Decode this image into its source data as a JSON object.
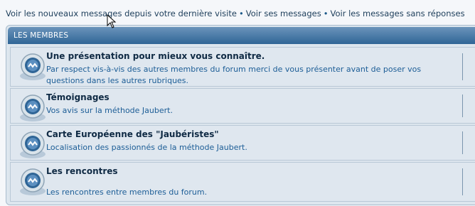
{
  "topnav": {
    "links": [
      "Voir les nouveaux messages depuis votre dernière visite",
      "Voir ses messages",
      "Voir les messages sans réponses"
    ],
    "separator": "•"
  },
  "forum": {
    "category_title": "LES MEMBRES",
    "rows": [
      {
        "title": "Une présentation pour mieux vous connaître.",
        "description": "Par respect vis-à-vis des autres membres du forum merci de vous présenter avant de poser vos questions dans les autres rubriques.",
        "icon": "forum-read-icon"
      },
      {
        "title": "Témoignages",
        "description": "Vos avis sur la méthode Jaubert.",
        "icon": "forum-read-icon"
      },
      {
        "title": "Carte Européenne des \"Jaubéristes\"",
        "description": "Localisation des passionnés de la méthode Jaubert.",
        "icon": "forum-read-icon"
      },
      {
        "title": "Les rencontres",
        "description": "Les rencontres entre membres du forum.",
        "icon": "forum-read-icon"
      }
    ]
  },
  "colors": {
    "link": "#1c3d5a",
    "header_gradient_top": "#6b94bb",
    "header_gradient_bottom": "#2f6596",
    "row_bg": "#dfe7ef",
    "description": "#1c5d96"
  }
}
